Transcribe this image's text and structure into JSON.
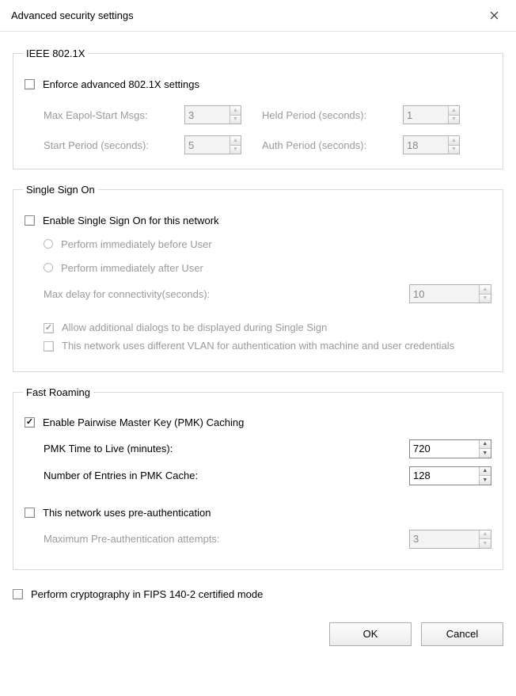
{
  "window": {
    "title": "Advanced security settings"
  },
  "ieee8021x": {
    "legend": "IEEE 802.1X",
    "enforce": {
      "label": "Enforce advanced 802.1X settings",
      "checked": false
    },
    "max_eapol_label": "Max Eapol-Start Msgs:",
    "max_eapol_value": "3",
    "held_period_label": "Held Period (seconds):",
    "held_period_value": "1",
    "start_period_label": "Start Period (seconds):",
    "start_period_value": "5",
    "auth_period_label": "Auth Period (seconds):",
    "auth_period_value": "18"
  },
  "sso": {
    "legend": "Single Sign On",
    "enable": {
      "label": "Enable Single Sign On for this network",
      "checked": false
    },
    "before_label": "Perform immediately before User",
    "after_label": "Perform immediately after User",
    "max_delay_label": "Max delay for connectivity(seconds):",
    "max_delay_value": "10",
    "allow_dialogs": {
      "label": "Allow additional dialogs to be displayed during Single Sign",
      "checked": true
    },
    "diff_vlan": {
      "label": "This network uses different VLAN for authentication with machine and user credentials",
      "checked": false
    }
  },
  "fast_roaming": {
    "legend": "Fast Roaming",
    "pmk_caching": {
      "label": "Enable Pairwise Master Key (PMK) Caching",
      "checked": true
    },
    "pmk_ttl_label": "PMK Time to Live (minutes):",
    "pmk_ttl_value": "720",
    "pmk_entries_label": "Number of Entries in PMK Cache:",
    "pmk_entries_value": "128",
    "preauth": {
      "label": "This network uses pre-authentication",
      "checked": false
    },
    "max_preauth_label": "Maximum Pre-authentication attempts:",
    "max_preauth_value": "3"
  },
  "fips": {
    "label": "Perform cryptography in FIPS 140-2 certified mode",
    "checked": false
  },
  "buttons": {
    "ok": "OK",
    "cancel": "Cancel"
  }
}
